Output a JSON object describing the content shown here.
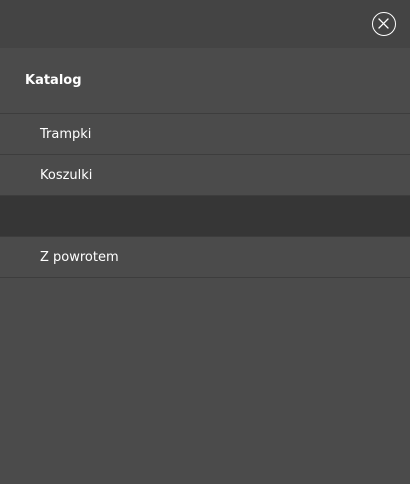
{
  "header": {
    "close_icon": "close-circle-icon"
  },
  "menu": {
    "title": "Katalog",
    "items": [
      {
        "label": "Trampki"
      },
      {
        "label": "Koszulki"
      },
      {
        "label": ""
      },
      {
        "label": "Z powrotem"
      }
    ]
  },
  "colors": {
    "background": "#4b4b4b",
    "top_bar": "#444444",
    "active_item": "#363636",
    "divider": "#3d3d3d",
    "text": "#ffffff"
  }
}
